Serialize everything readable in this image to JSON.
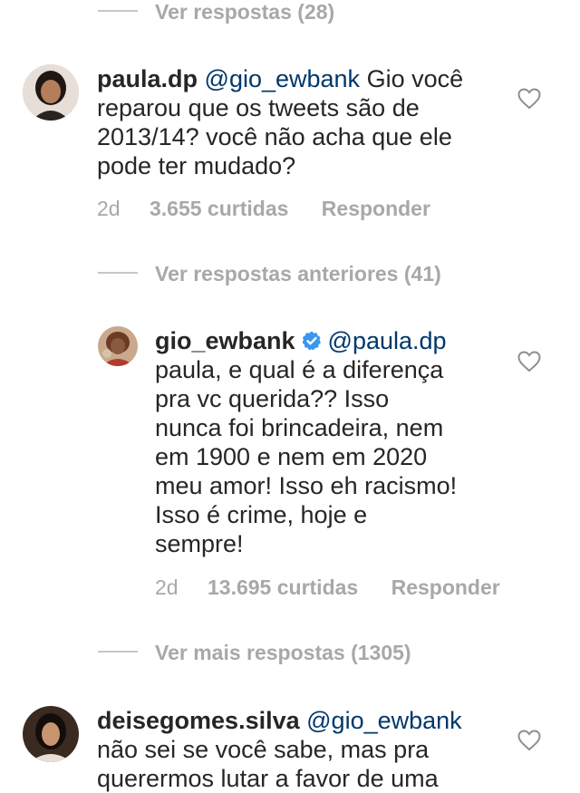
{
  "thread": {
    "replies_link_1": "Ver respostas (28)",
    "replies_link_2": "Ver respostas anteriores (41)",
    "replies_link_3": "Ver mais respostas (1305)"
  },
  "comments": [
    {
      "username": "paula.dp",
      "mention": "@gio_ewbank",
      "text_lines": [
        "Gio você",
        "reparou que os tweets são de",
        "2013/14? você não acha que ele",
        "pode ter mudado?"
      ],
      "age": "2d",
      "likes": "3.655 curtidas",
      "reply": "Responder"
    },
    {
      "username": "gio_ewbank",
      "verified": true,
      "mention": "@paula.dp",
      "text_lines": [
        "paula, e qual é a diferença",
        "pra vc querida?? Isso",
        "nunca foi brincadeira, nem",
        "em 1900 e nem em 2020",
        "meu amor! Isso eh racismo!",
        "Isso é crime, hoje e",
        "sempre!"
      ],
      "age": "2d",
      "likes": "13.695 curtidas",
      "reply": "Responder"
    },
    {
      "username": "deisegomes.silva",
      "mention": "@gio_ewbank",
      "text_lines": [
        "não sei se você sabe, mas pra",
        "querermos lutar a favor de uma"
      ]
    }
  ],
  "colors": {
    "muted": "#a8a8a8",
    "mention": "#00376b",
    "verified": "#3897f0",
    "text": "#262626"
  },
  "icons": {
    "like": "heart-icon",
    "verified": "verified-badge-icon"
  }
}
